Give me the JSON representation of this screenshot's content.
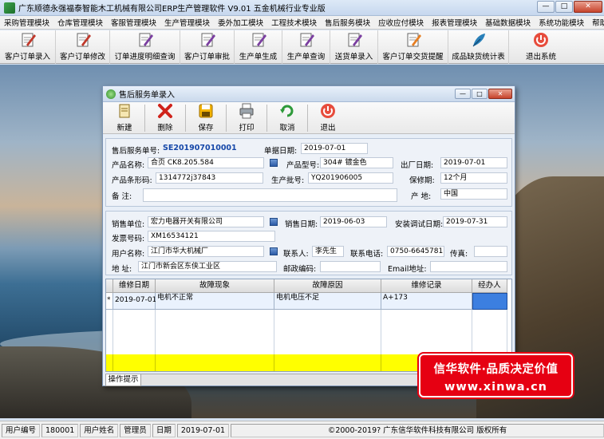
{
  "app": {
    "title": "广东顺德永强福泰智能木工机械有限公司ERP生产管理软件 V9.01 五金机械行业专业版",
    "min": "—",
    "max": "□",
    "close": "✕"
  },
  "menu": [
    "采购管理模块",
    "仓库管理模块",
    "客服管理模块",
    "生产管理模块",
    "委外加工模块",
    "工程技术模块",
    "售后服务模块",
    "应收应付模块",
    "报表管理模块",
    "基础数据模块",
    "系统功能模块",
    "帮助"
  ],
  "toolbar": [
    {
      "label": "客户订单录入",
      "icon": "pencil-notepad-icon",
      "color": "#c0392b"
    },
    {
      "label": "客户订单修改",
      "icon": "pencil-notepad-icon",
      "color": "#c0392b"
    },
    {
      "label": "订单进度明细查询",
      "icon": "pencil-notepad-icon",
      "color": "#7b3fa0"
    },
    {
      "label": "客户订单审批",
      "icon": "pencil-notepad-icon",
      "color": "#7b3fa0"
    },
    {
      "label": "生产单生成",
      "icon": "pencil-notepad-icon",
      "color": "#7b3fa0"
    },
    {
      "label": "生产单查询",
      "icon": "pencil-notepad-icon",
      "color": "#7b3fa0"
    },
    {
      "label": "送货单录入",
      "icon": "pencil-notepad-icon",
      "color": "#7b3fa0"
    },
    {
      "label": "客户订单交货提醒",
      "icon": "pencil-notepad-icon",
      "color": "#e67e22"
    },
    {
      "label": "成品缺货统计表",
      "icon": "feather-pen-icon",
      "color": "#2980b9"
    },
    {
      "label": "退出系统",
      "icon": "exit-power-icon",
      "color": "#e74c3c"
    }
  ],
  "dialog": {
    "title": "售后服务单录入",
    "tools": [
      {
        "label": "新建",
        "icon": "new-doc-icon"
      },
      {
        "label": "删除",
        "icon": "delete-x-icon"
      },
      {
        "label": "保存",
        "icon": "save-icon"
      },
      {
        "label": "打印",
        "icon": "printer-icon"
      },
      {
        "label": "取消",
        "icon": "cancel-refresh-icon"
      },
      {
        "label": "退出",
        "icon": "exit-power-icon"
      }
    ],
    "f1": {
      "service_no_label": "售后服务单号:",
      "service_no": "SE201907010001",
      "doc_date_label": "单据日期:",
      "doc_date": "2019-07-01",
      "product_name_label": "产品名称:",
      "product_name": "合页 CK8.205.584",
      "model_label": "产品型号:",
      "model": "304# 镀金色",
      "factory_date_label": "出厂日期:",
      "factory_date": "2019-07-01",
      "barcode_label": "产品条形码:",
      "barcode": "1314772j37843",
      "batch_label": "生产批号:",
      "batch": "YQ201906005",
      "warranty_label": "保修期:",
      "warranty": "12个月",
      "remark_label": "备  注:",
      "remark": "",
      "origin_label": "产  地:",
      "origin": "中国"
    },
    "f2": {
      "seller_label": "销售单位:",
      "seller": "宏力电器开关有限公司",
      "sale_date_label": "销售日期:",
      "sale_date": "2019-06-03",
      "install_date_label": "安装调试日期:",
      "install_date": "2019-07-31",
      "invoice_label": "发票号码:",
      "invoice": "XM16534121",
      "user_label": "用户名称:",
      "user": "江门市华大机械厂",
      "contact_label": "联系人:",
      "contact": "李先生",
      "phone_label": "联系电话:",
      "phone": "0750-6645781",
      "fax_label": "传真:",
      "fax": "",
      "addr_label": "地  址:",
      "addr": "江门市新会区东侠工业区",
      "zip_label": "邮政编码:",
      "zip": "",
      "email_label": "Email地址:",
      "email": ""
    },
    "grid": {
      "headers": [
        "维修日期",
        "故障现象",
        "故障原因",
        "维修记录",
        "经办人"
      ],
      "rows": [
        {
          "marker": "*",
          "date": "2019-07-01",
          "symptom": "电机不正常",
          "cause": "电机电压不足",
          "record": "A+173",
          "handler": ""
        }
      ]
    },
    "tab": "操作提示"
  },
  "banner": {
    "line1": "信华软件·品质决定价值",
    "line2": "www.xinwa.cn"
  },
  "status": {
    "user_no_label": "用户编号",
    "user_no": "180001",
    "user_name_label": "用户姓名",
    "user_name": "管理员",
    "date_label": "日期",
    "date": "2019-07-01",
    "copyright": "©2000-2019? 广东信华软件科技有限公司 版权所有"
  }
}
